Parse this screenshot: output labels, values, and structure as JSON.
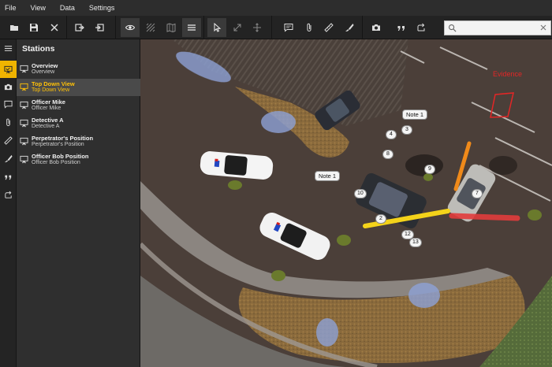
{
  "menu": {
    "items": [
      "File",
      "View",
      "Data",
      "Settings"
    ]
  },
  "toolbar": {
    "buttons": [
      {
        "name": "open-folder-icon"
      },
      {
        "name": "save-icon"
      },
      {
        "name": "close-icon"
      },
      {
        "name": "import-icon"
      },
      {
        "name": "export-icon"
      },
      {
        "name": "eye-icon"
      },
      {
        "name": "point-density-icon"
      },
      {
        "name": "map-icon"
      },
      {
        "name": "list-menu-icon"
      },
      {
        "name": "pointer-icon"
      },
      {
        "name": "expand-icon"
      },
      {
        "name": "move-icon"
      },
      {
        "name": "comment-icon"
      },
      {
        "name": "attachment-icon"
      },
      {
        "name": "measure-icon"
      },
      {
        "name": "brush-icon"
      },
      {
        "name": "camera-icon"
      },
      {
        "name": "quote-icon"
      },
      {
        "name": "share-icon"
      }
    ],
    "search": {
      "placeholder": "",
      "value": ""
    }
  },
  "rail": {
    "items": [
      "stations-icon",
      "camera-icon",
      "comment-icon",
      "attachment-icon",
      "measure-icon",
      "brush-icon",
      "quote-icon",
      "share-icon"
    ]
  },
  "stations": {
    "title": "Stations",
    "items": [
      {
        "name": "Overview",
        "subtitle": "Overview",
        "selected": false
      },
      {
        "name": "Top Down View",
        "subtitle": "Top Down View",
        "selected": true
      },
      {
        "name": "Officer Mike",
        "subtitle": "Officer Mike",
        "selected": false
      },
      {
        "name": "Detective A",
        "subtitle": "Detective A",
        "selected": false
      },
      {
        "name": "Perpetrator's Position",
        "subtitle": "Perpetrator's Position",
        "selected": false
      },
      {
        "name": "Officer Bob Position",
        "subtitle": "Officer Bob Position",
        "selected": false
      }
    ]
  },
  "scene": {
    "notes": [
      "Note 1",
      "Note 1"
    ],
    "markers": [
      "1",
      "2",
      "3",
      "4",
      "7",
      "8",
      "9",
      "10",
      "12",
      "13"
    ],
    "evidence_label": "Evidence"
  },
  "colors": {
    "accent": "#f0b400",
    "evidence": "#e32626",
    "selected_row": "#4a4a4a"
  }
}
